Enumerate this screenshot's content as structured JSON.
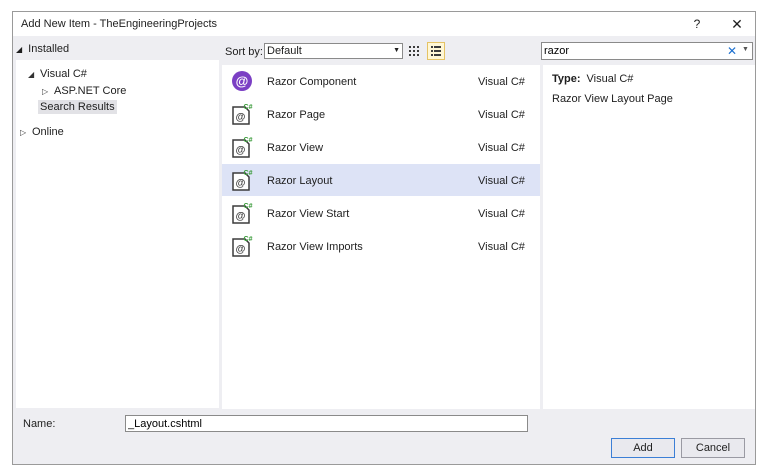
{
  "window": {
    "title": "Add New Item - TheEngineeringProjects",
    "help": "?",
    "close": "✕"
  },
  "left": {
    "header": "Installed",
    "tree": {
      "visual_cs": "Visual C#",
      "aspnet": "ASP.NET Core",
      "search_results": "Search Results",
      "online": "Online"
    }
  },
  "toolbar": {
    "sort_label": "Sort by:",
    "sort_value": "Default",
    "search_value": "razor"
  },
  "items": [
    {
      "name": "Razor Component",
      "lang": "Visual C#",
      "icon": "razor-component-icon"
    },
    {
      "name": "Razor Page",
      "lang": "Visual C#",
      "icon": "razor-file-icon"
    },
    {
      "name": "Razor View",
      "lang": "Visual C#",
      "icon": "razor-file-icon"
    },
    {
      "name": "Razor Layout",
      "lang": "Visual C#",
      "icon": "razor-file-icon"
    },
    {
      "name": "Razor View Start",
      "lang": "Visual C#",
      "icon": "razor-file-icon"
    },
    {
      "name": "Razor View Imports",
      "lang": "Visual C#",
      "icon": "razor-file-icon"
    }
  ],
  "details": {
    "type_label": "Type:",
    "type_value": "Visual C#",
    "description": "Razor View Layout Page"
  },
  "bottom": {
    "name_label": "Name:",
    "name_value": "_Layout.cshtml",
    "add_label": "Add",
    "cancel_label": "Cancel"
  },
  "colors": {
    "accent": "#1c70d0",
    "selection": "#dde3f6",
    "razor_purple": "#7b3fc4",
    "cs_green": "#3a9b3a"
  }
}
